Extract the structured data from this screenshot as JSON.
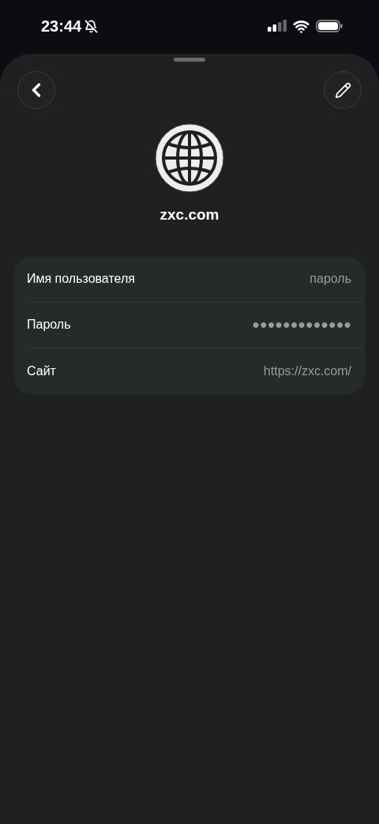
{
  "status_bar": {
    "time": "23:44"
  },
  "site": {
    "title": "zxc.com"
  },
  "fields": [
    {
      "label": "Имя пользователя",
      "value": "пароль"
    },
    {
      "label": "Пароль",
      "value": "●●●●●●●●●●●●●"
    },
    {
      "label": "Сайт",
      "value": "https://zxc.com/"
    }
  ]
}
